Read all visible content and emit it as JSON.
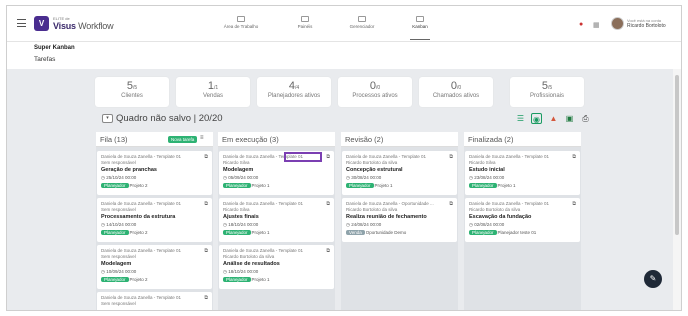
{
  "header": {
    "logo_initial": "V",
    "logo_small": "ELITE de",
    "logo_brand": "Visus",
    "logo_rest": " Workflow",
    "nav": [
      {
        "label": "Área de Trabalho"
      },
      {
        "label": "Painéis"
      },
      {
        "label": "Gerenciador"
      },
      {
        "label": "Kanban"
      }
    ],
    "user_small": "Você está na conta",
    "user_name": "Ricardo Bortoloto"
  },
  "page": {
    "title": "Super Kanban",
    "tab": "Tarefas"
  },
  "stats": [
    {
      "value": "5",
      "total": "/5",
      "label": "Clientes"
    },
    {
      "value": "1",
      "total": "/1",
      "label": "Vendas"
    },
    {
      "value": "4",
      "total": "/4",
      "label": "Planejadores ativos"
    },
    {
      "value": "0",
      "total": "/0",
      "label": "Processos ativos"
    },
    {
      "value": "0",
      "total": "/0",
      "label": "Chamados ativos"
    },
    {
      "value": "5",
      "total": "/5",
      "label": "Profissionais"
    }
  ],
  "board": {
    "title": "Quadro não salvo | 20/20"
  },
  "columns": [
    {
      "title": "Fila (13)",
      "new_label": "Nova tarefa",
      "cards": [
        {
          "title": "Daniela de Souza Zanella - Template 01",
          "resp": "Sem responsável",
          "name": "Geração de pranchas",
          "date": "25/10/24 00:00",
          "tag": "Planejador",
          "proj": "Projeto 2"
        },
        {
          "title": "Daniela de Souza Zanella - Template 01",
          "resp": "Sem responsável",
          "name": "Processamento da estrutura",
          "date": "14/10/24 00:00",
          "tag": "Planejador",
          "proj": "Projeto 2"
        },
        {
          "title": "Daniela de Souza Zanella - Template 01",
          "resp": "Sem responsável",
          "name": "Modelagem",
          "date": "10/09/24 00:00",
          "tag": "Planejador",
          "proj": "Projeto 2"
        },
        {
          "title": "Daniela de Souza Zanella - Template 01",
          "resp": "Sem responsável",
          "name": "",
          "date": "",
          "tag": "",
          "proj": ""
        }
      ]
    },
    {
      "title": "Em execução (3)",
      "cards": [
        {
          "title": "Daniela de Souza Zanella - Template 01",
          "resp": "Ricardo Silva",
          "name": "Modelagem",
          "date": "05/09/24 00:00",
          "tag": "Planejador",
          "proj": "Projeto 1"
        },
        {
          "title": "Daniela de Souza Zanella - Template 01",
          "resp": "Ricardo Silva",
          "name": "Ajustes finais",
          "date": "18/10/24 00:00",
          "tag": "Planejador",
          "proj": "Projeto 1"
        },
        {
          "title": "Daniela de Souza Zanella - Template 01",
          "resp": "Ricardo Bortoloto da silva",
          "name": "Análise de resultados",
          "date": "18/10/24 00:00",
          "tag": "Planejador",
          "proj": "Projeto 1"
        }
      ]
    },
    {
      "title": "Revisão (2)",
      "cards": [
        {
          "title": "Daniela de Souza Zanella - Template 01",
          "resp": "Ricardo Bortoloto da silva",
          "name": "Concepção estrutural",
          "date": "30/08/24 00:00",
          "tag": "Planejador",
          "proj": "Projeto 1"
        },
        {
          "title": "Daniela de Souza Zanella - Oportunidade ...",
          "resp": "Ricardo Bortoloto da silva",
          "name": "Realiza reunião de fechamento",
          "date": "24/08/24 00:00",
          "tag": "Venda",
          "proj": "Oportunidade Demo"
        }
      ]
    },
    {
      "title": "Finalizada (2)",
      "cards": [
        {
          "title": "Daniela de Souza Zanella - Template 01",
          "resp": "Ricardo Silva",
          "name": "Estudo inicial",
          "date": "23/08/24 00:00",
          "tag": "Planejador",
          "proj": "Projeto 1"
        },
        {
          "title": "Daniela de Souza Zanella - Template 01",
          "resp": "Ricardo Bortoloto da silva",
          "name": "Escavação da fundação",
          "date": "02/08/24 00:00",
          "tag": "Planejador",
          "proj": "Planejador teste 01"
        }
      ]
    }
  ],
  "colors": {
    "accent": "#2db273",
    "brand": "#4a2d8f",
    "highlight": "#7b3fb2"
  }
}
